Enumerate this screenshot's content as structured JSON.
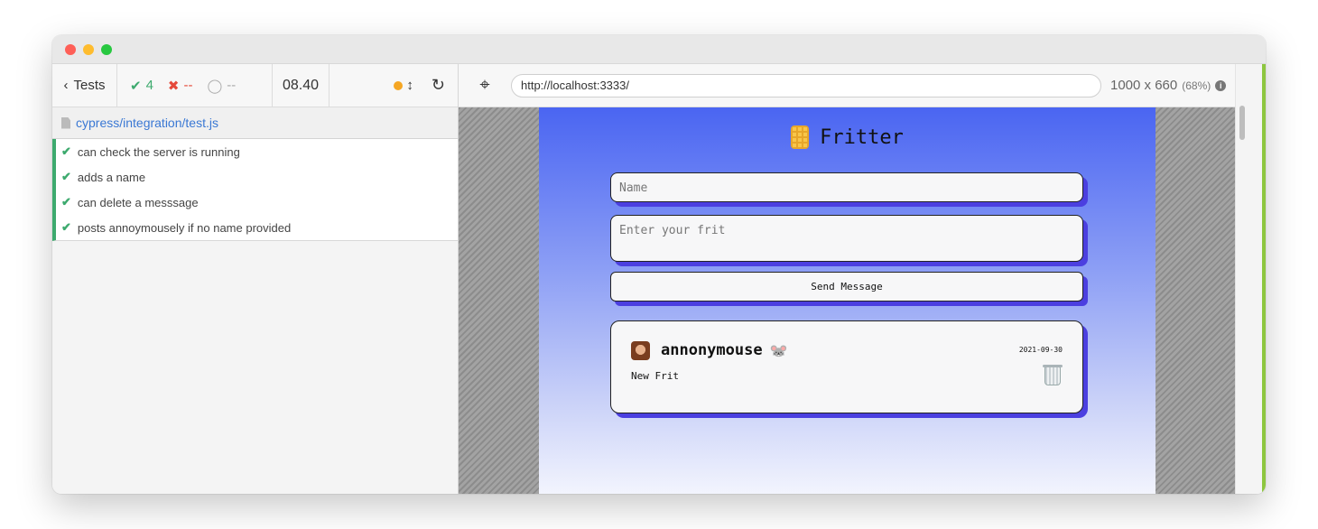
{
  "reporter": {
    "back_label": "Tests",
    "passed": "4",
    "failed": "--",
    "pending": "--",
    "duration": "08.40",
    "spec_path": "cypress/integration/test.js",
    "tests": [
      {
        "title": "can check the server is running"
      },
      {
        "title": "adds a name"
      },
      {
        "title": "can delete a messsage"
      },
      {
        "title": "posts annoymousely if no name provided"
      }
    ]
  },
  "aut": {
    "url": "http://localhost:3333/",
    "viewport": "1000 x 660",
    "scale": "(68%)"
  },
  "app": {
    "title": "Fritter",
    "name_placeholder": "Name",
    "frit_placeholder": "Enter your frit",
    "send_label": "Send Message",
    "message": {
      "username": "annonymouse",
      "user_emoji": "🐭",
      "date": "2021-09-30",
      "text": "New Frit"
    }
  },
  "colors": {
    "pass": "#3daa6e",
    "fail": "#e5493a",
    "accent_shadow": "#4b3fe0",
    "app_bg_top": "#4a65f2"
  }
}
